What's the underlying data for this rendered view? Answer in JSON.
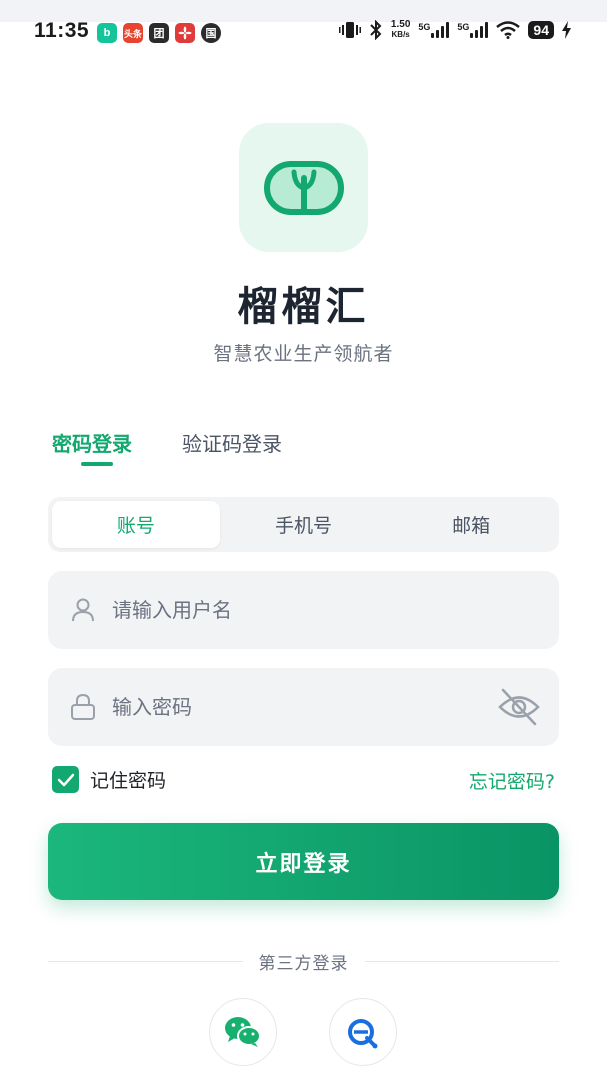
{
  "status_bar": {
    "time": "11:35",
    "notification_icons": [
      "bilibili-icon",
      "toutiao-icon",
      "tuan-icon",
      "huawei-icon",
      "guo-icon"
    ],
    "notification_labels": {
      "bilibili": "b",
      "toutiao": "头条",
      "tuan": "团",
      "guo": "国"
    },
    "net_speed_value": "1.50",
    "net_speed_unit": "KB/s",
    "signal_1_label": "5G",
    "signal_2_label": "5G",
    "battery": "94"
  },
  "app": {
    "name": "榴榴汇",
    "slogan": "智慧农业生产领航者",
    "logo_icon": "sprout-logo-icon"
  },
  "login_tabs": {
    "password_login": "密码登录",
    "code_login": "验证码登录",
    "active": "password_login"
  },
  "account_type": {
    "options": [
      "账号",
      "手机号",
      "邮箱"
    ],
    "selected": "账号"
  },
  "username_field": {
    "placeholder": "请输入用户名",
    "value": ""
  },
  "password_field": {
    "placeholder": "输入密码",
    "value": ""
  },
  "remember": {
    "label": "记住密码",
    "checked": true
  },
  "forgot_label": "忘记密码?",
  "login_button_label": "立即登录",
  "third_party": {
    "divider_label": "第三方登录",
    "providers": [
      "wechat-icon",
      "qq-icon"
    ]
  },
  "colors": {
    "accent": "#13a86f",
    "logo_bg": "#e6f7ef",
    "field_bg": "#f1f3f5"
  }
}
